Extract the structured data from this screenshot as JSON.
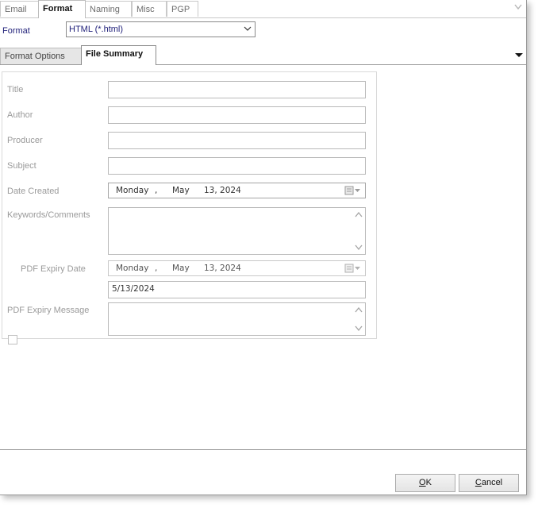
{
  "top_tabs": [
    {
      "label": "Email",
      "active": false
    },
    {
      "label": "Format",
      "active": true
    },
    {
      "label": "Naming",
      "active": false
    },
    {
      "label": "Misc",
      "active": false
    },
    {
      "label": "PGP",
      "active": false
    }
  ],
  "format": {
    "label": "Format",
    "value": "HTML (*.html)"
  },
  "sub_tabs": [
    {
      "label": "Format Options",
      "active": false
    },
    {
      "label": "File Summary",
      "active": true
    }
  ],
  "fields": {
    "title": {
      "label": "Title",
      "value": ""
    },
    "author": {
      "label": "Author",
      "value": ""
    },
    "producer": {
      "label": "Producer",
      "value": ""
    },
    "subject": {
      "label": "Subject",
      "value": ""
    },
    "date_created": {
      "label": "Date Created",
      "weekday": "Monday",
      "sep": ",",
      "month": "May",
      "day_year": "13, 2024"
    },
    "keywords": {
      "label": "Keywords/Comments",
      "value": ""
    },
    "pdf_expiry": {
      "label": "PDF Expiry Date",
      "checked": false,
      "weekday": "Monday",
      "sep": ",",
      "month": "May",
      "day_year": "13, 2024",
      "short_date": "5/13/2024"
    },
    "pdf_expiry_message": {
      "label": "PDF Expiry Message",
      "value": ""
    }
  },
  "buttons": {
    "ok": {
      "first": "O",
      "rest": "K"
    },
    "cancel": {
      "first": "C",
      "rest": "ancel"
    }
  },
  "colors": {
    "accent_text": "#1e1e78",
    "disabled_label": "#9a9a9a"
  }
}
